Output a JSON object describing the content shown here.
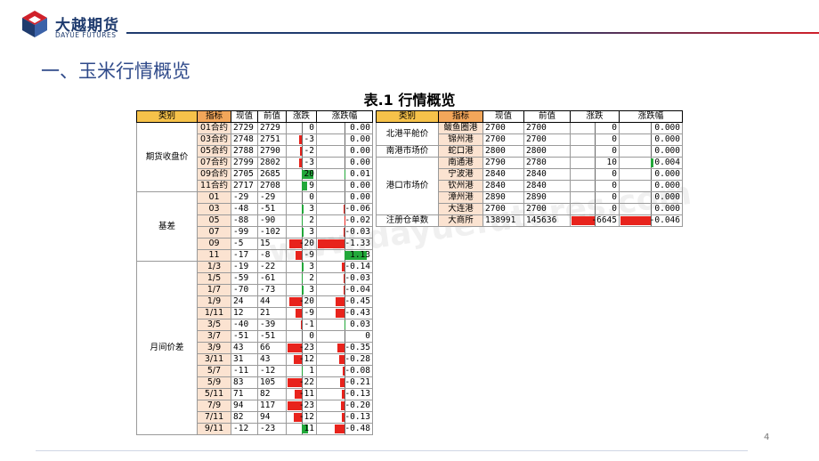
{
  "header": {
    "logo_cn": "大越期货",
    "logo_en": "DAYUE FUTURES",
    "section_title": "一、玉米行情概览",
    "table_caption": "表.1 行情概览",
    "page_number": "4",
    "colors": {
      "brand_blue": "#1f3b6e",
      "accent_red": "#d0202a",
      "neg_bar": "#e8231c",
      "pos_bar": "#22a83a"
    }
  },
  "left_table": {
    "headers": [
      "类别",
      "指标",
      "现值",
      "前值",
      "涨跌",
      "涨跌幅"
    ],
    "groups": [
      {
        "category": "期货收盘价",
        "rows": [
          {
            "ind": "01合约",
            "cur": "2729",
            "prev": "2729",
            "chg": "0",
            "pct": "0.00"
          },
          {
            "ind": "03合约",
            "cur": "2748",
            "prev": "2751",
            "chg": "-3",
            "pct": "0.00"
          },
          {
            "ind": "05合约",
            "cur": "2788",
            "prev": "2790",
            "chg": "-2",
            "pct": "0.00"
          },
          {
            "ind": "07合约",
            "cur": "2799",
            "prev": "2802",
            "chg": "-3",
            "pct": "0.00"
          },
          {
            "ind": "09合约",
            "cur": "2705",
            "prev": "2685",
            "chg": "20",
            "pct": "0.01"
          },
          {
            "ind": "11合约",
            "cur": "2717",
            "prev": "2708",
            "chg": "9",
            "pct": "0.00"
          }
        ]
      },
      {
        "category": "基差",
        "rows": [
          {
            "ind": "01",
            "cur": "-29",
            "prev": "-29",
            "chg": "0",
            "pct": "0.00"
          },
          {
            "ind": "03",
            "cur": "-48",
            "prev": "-51",
            "chg": "3",
            "pct": "-0.06"
          },
          {
            "ind": "05",
            "cur": "-88",
            "prev": "-90",
            "chg": "2",
            "pct": "-0.02"
          },
          {
            "ind": "07",
            "cur": "-99",
            "prev": "-102",
            "chg": "3",
            "pct": "-0.03"
          },
          {
            "ind": "09",
            "cur": "-5",
            "prev": "15",
            "chg": "-20",
            "pct": "-1.33"
          },
          {
            "ind": "11",
            "cur": "-17",
            "prev": "-8",
            "chg": "-9",
            "pct": "1.13"
          }
        ]
      },
      {
        "category": "月间价差",
        "rows": [
          {
            "ind": "1/3",
            "cur": "-19",
            "prev": "-22",
            "chg": "3",
            "pct": "-0.14"
          },
          {
            "ind": "1/5",
            "cur": "-59",
            "prev": "-61",
            "chg": "2",
            "pct": "-0.03"
          },
          {
            "ind": "1/7",
            "cur": "-70",
            "prev": "-73",
            "chg": "3",
            "pct": "-0.04"
          },
          {
            "ind": "1/9",
            "cur": "24",
            "prev": "44",
            "chg": "-20",
            "pct": "-0.45"
          },
          {
            "ind": "1/11",
            "cur": "12",
            "prev": "21",
            "chg": "-9",
            "pct": "-0.43"
          },
          {
            "ind": "3/5",
            "cur": "-40",
            "prev": "-39",
            "chg": "-1",
            "pct": "0.03"
          },
          {
            "ind": "3/7",
            "cur": "-51",
            "prev": "-51",
            "chg": "0",
            "pct": "0"
          },
          {
            "ind": "3/9",
            "cur": "43",
            "prev": "66",
            "chg": "-23",
            "pct": "-0.35"
          },
          {
            "ind": "3/11",
            "cur": "31",
            "prev": "43",
            "chg": "-12",
            "pct": "-0.28"
          },
          {
            "ind": "5/7",
            "cur": "-11",
            "prev": "-12",
            "chg": "1",
            "pct": "-0.08"
          },
          {
            "ind": "5/9",
            "cur": "83",
            "prev": "105",
            "chg": "-22",
            "pct": "-0.21"
          },
          {
            "ind": "5/11",
            "cur": "71",
            "prev": "82",
            "chg": "-11",
            "pct": "-0.13"
          },
          {
            "ind": "7/9",
            "cur": "94",
            "prev": "117",
            "chg": "-23",
            "pct": "-0.20"
          },
          {
            "ind": "7/11",
            "cur": "82",
            "prev": "94",
            "chg": "-12",
            "pct": "-0.13"
          },
          {
            "ind": "9/11",
            "cur": "-12",
            "prev": "-23",
            "chg": "11",
            "pct": "-0.48"
          }
        ]
      }
    ]
  },
  "right_table": {
    "headers": [
      "类别",
      "指标",
      "现值",
      "前值",
      "涨跌",
      "涨跌幅"
    ],
    "groups": [
      {
        "category": "北港平舱价",
        "rows": [
          {
            "ind": "鲅鱼圈港",
            "cur": "2700",
            "prev": "2700",
            "chg": "0",
            "pct": "0.000"
          },
          {
            "ind": "锦州港",
            "cur": "2700",
            "prev": "2700",
            "chg": "0",
            "pct": "0.000"
          }
        ]
      },
      {
        "category": "南港市场价",
        "rows": [
          {
            "ind": "蛇口港",
            "cur": "2800",
            "prev": "2800",
            "chg": "0",
            "pct": "0.000"
          }
        ]
      },
      {
        "category": "港口市场价",
        "rows": [
          {
            "ind": "南通港",
            "cur": "2790",
            "prev": "2780",
            "chg": "10",
            "pct": "0.004"
          },
          {
            "ind": "宁波港",
            "cur": "2840",
            "prev": "2840",
            "chg": "0",
            "pct": "0.000"
          },
          {
            "ind": "钦州港",
            "cur": "2840",
            "prev": "2840",
            "chg": "0",
            "pct": "0.000"
          },
          {
            "ind": "漳州港",
            "cur": "2890",
            "prev": "2890",
            "chg": "0",
            "pct": "0.000"
          },
          {
            "ind": "大连港",
            "cur": "2700",
            "prev": "2700",
            "chg": "0",
            "pct": "0.000"
          }
        ]
      },
      {
        "category": "注册仓单数",
        "rows": [
          {
            "ind": "大商所",
            "cur": "138991",
            "prev": "145636",
            "chg": "-6645",
            "pct": "-0.046"
          }
        ]
      }
    ]
  },
  "watermark": "www.dayuefutures.com"
}
